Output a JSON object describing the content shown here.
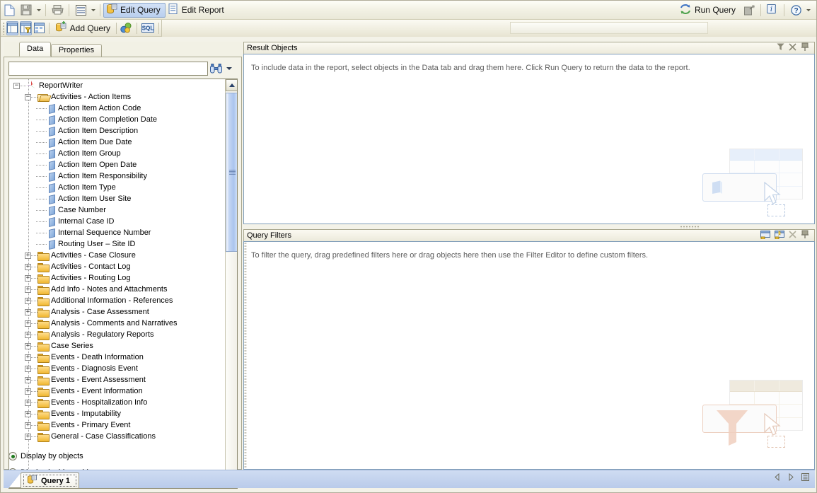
{
  "topbar": {
    "icons": [
      "new-document-icon",
      "save-icon",
      "print-icon",
      "view-icon"
    ],
    "edit_query_label": "Edit Query",
    "edit_report_label": "Edit Report",
    "run_query_label": "Run Query",
    "right_icons": [
      "run-query-icon",
      "close-query-icon",
      "info-icon",
      "help-icon"
    ]
  },
  "toolbar2": {
    "add_query_label": "Add Query",
    "icons": [
      "show-result-objects-icon",
      "show-query-filters-icon",
      "show-data-preview-icon",
      "add-query-icon",
      "scope-of-analysis-icon",
      "view-sql-icon"
    ]
  },
  "left_panel": {
    "tabs": [
      {
        "label": "Data",
        "active": true
      },
      {
        "label": "Properties",
        "active": false
      }
    ],
    "search": {
      "value": "",
      "placeholder": "",
      "button_icon": "binoculars-icon",
      "dropdown_icon": "chevron-down-icon"
    },
    "tree": {
      "root": "ReportWriter",
      "open_folder": "Activities - Action Items",
      "objects": [
        "Action Item Action Code",
        "Action Item Completion Date",
        "Action Item Description",
        "Action Item Due Date",
        "Action Item Group",
        "Action Item Open Date",
        "Action Item Responsibility",
        "Action Item Type",
        "Action Item User Site",
        "Case Number",
        "Internal Case ID",
        "Internal Sequence Number",
        "Routing User – Site ID"
      ],
      "folders": [
        "Activities - Case Closure",
        "Activities - Contact Log",
        "Activities - Routing Log",
        "Add Info - Notes and Attachments",
        "Additional Information - References",
        "Analysis - Case Assessment",
        "Analysis - Comments and Narratives",
        "Analysis - Regulatory Reports",
        "Case Series",
        "Events - Death Information",
        "Events - Diagnosis Event",
        "Events - Event Assessment",
        "Events - Event Information",
        "Events - Hospitalization Info",
        "Events - Imputability",
        "Events - Primary Event",
        "General - Case Classifications"
      ]
    },
    "display_options": [
      {
        "label": "Display by objects",
        "selected": true
      },
      {
        "label": "Display by hierarchies",
        "selected": false
      }
    ]
  },
  "result_objects_panel": {
    "title": "Result Objects",
    "hint": "To include data in the report, select objects in the Data tab and drag them here. Click Run Query to return the data to the report.",
    "icons": [
      "filter-icon",
      "close-icon",
      "pin-icon"
    ]
  },
  "query_filters_panel": {
    "title": "Query Filters",
    "hint": "To filter the query, drag predefined filters here or drag objects here then use the Filter Editor to define custom filters.",
    "icons": [
      "add-filter-icon",
      "add-quick-filter-icon",
      "close-icon",
      "pin-icon"
    ]
  },
  "query_tab_bar": {
    "tabs": [
      {
        "label": "Query 1",
        "active": true
      }
    ],
    "nav_icons": [
      "previous-icon",
      "next-icon",
      "list-icon"
    ]
  },
  "colors": {
    "accent_blue": "#b9cbea",
    "folder_yellow": "#f0b731",
    "object_blue": "#7fa7d8",
    "panel_bg": "#f3f2e8",
    "radio_green": "#1f7a1f"
  }
}
